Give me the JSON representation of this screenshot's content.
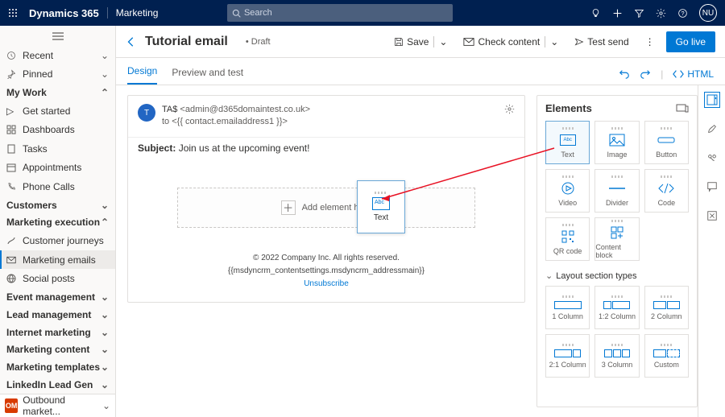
{
  "topbar": {
    "product": "Dynamics 365",
    "module": "Marketing",
    "search_placeholder": "Search",
    "avatar": "NU"
  },
  "nav": {
    "recent": "Recent",
    "pinned": "Pinned",
    "group_mywork": "My Work",
    "get_started": "Get started",
    "dashboards": "Dashboards",
    "tasks": "Tasks",
    "appointments": "Appointments",
    "phone_calls": "Phone Calls",
    "group_customers": "Customers",
    "group_marketing_exec": "Marketing execution",
    "customer_journeys": "Customer journeys",
    "marketing_emails": "Marketing emails",
    "social_posts": "Social posts",
    "group_event": "Event management",
    "group_lead": "Lead management",
    "group_internet": "Internet marketing",
    "group_content": "Marketing content",
    "group_templates": "Marketing templates",
    "group_linkedin": "LinkedIn Lead Gen",
    "switcher_code": "OM",
    "switcher_label": "Outbound market..."
  },
  "cmdbar": {
    "title": "Tutorial email",
    "status": "Draft",
    "save": "Save",
    "check": "Check content",
    "test": "Test send",
    "golive": "Go live"
  },
  "tabs": {
    "design": "Design",
    "preview": "Preview and test",
    "html": "HTML"
  },
  "email": {
    "avatar": "T",
    "from_name": "TA$",
    "from_email": "<admin@d365domaintest.co.uk>",
    "to_line": "to  <{{ contact.emailaddress1 }}>",
    "subject_label": "Subject:",
    "subject_value": "Join us at the upcoming event!",
    "drop_label": "Add element here",
    "drag_label": "Text",
    "footer_copy": "© 2022 Company Inc. All rights reserved.",
    "footer_token": "{{msdyncrm_contentsettings.msdyncrm_addressmain}}",
    "unsubscribe": "Unsubscribe"
  },
  "panel": {
    "title": "Elements",
    "tiles": {
      "text": "Text",
      "image": "Image",
      "button": "Button",
      "video": "Video",
      "divider": "Divider",
      "code": "Code",
      "qr": "QR code",
      "content_block": "Content block"
    },
    "layout_title": "Layout section types",
    "layouts": {
      "c1": "1 Column",
      "c12": "1:2 Column",
      "c2": "2 Column",
      "c21": "2:1 Column",
      "c3": "3 Column",
      "custom": "Custom"
    }
  }
}
